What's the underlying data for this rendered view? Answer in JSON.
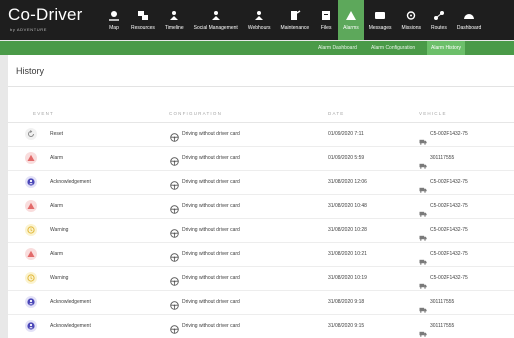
{
  "brand": {
    "name": "Co-Driver",
    "sub": "by ADVENTURE"
  },
  "nav": [
    {
      "label": "Map",
      "icon": "map-icon",
      "active": false
    },
    {
      "label": "Resources",
      "icon": "resources-icon",
      "active": false
    },
    {
      "label": "Timeline",
      "icon": "timeline-icon",
      "active": false
    },
    {
      "label": "Social Management",
      "icon": "social-management-icon",
      "active": false
    },
    {
      "label": "Webhours",
      "icon": "webhours-icon",
      "active": false
    },
    {
      "label": "Maintenance",
      "icon": "maintenance-icon",
      "active": false
    },
    {
      "label": "Files",
      "icon": "files-icon",
      "active": false
    },
    {
      "label": "Alarms",
      "icon": "alarms-icon",
      "active": true
    },
    {
      "label": "Messages",
      "icon": "messages-icon",
      "active": false
    },
    {
      "label": "Missions",
      "icon": "missions-icon",
      "active": false
    },
    {
      "label": "Routes",
      "icon": "routes-icon",
      "active": false
    },
    {
      "label": "Dashboard",
      "icon": "dashboard-icon",
      "active": false
    }
  ],
  "subnav": [
    {
      "label": "Alarm Dashboard",
      "active": false
    },
    {
      "label": "Alarm Configuration",
      "active": false
    },
    {
      "label": "Alarm History",
      "active": true
    }
  ],
  "page": {
    "title": "History"
  },
  "table": {
    "columns": {
      "event": "EVENT",
      "configuration": "CONFIGURATION",
      "date": "DATE",
      "vehicle": "VEHICLE"
    },
    "rows": [
      {
        "event": "Reset",
        "type": "reset",
        "configuration": "Driving without driver card",
        "date": "01/09/2020 7:11",
        "vehicle": "C5-002F1432-75"
      },
      {
        "event": "Alarm",
        "type": "alarm",
        "configuration": "Driving without driver card",
        "date": "01/09/2020 5:59",
        "vehicle": "301117555"
      },
      {
        "event": "Acknowledgement",
        "type": "ack",
        "configuration": "Driving without driver card",
        "date": "31/08/2020 12:06",
        "vehicle": "C5-002F1432-75"
      },
      {
        "event": "Alarm",
        "type": "alarm",
        "configuration": "Driving without driver card",
        "date": "31/08/2020 10:48",
        "vehicle": "C5-002F1432-75"
      },
      {
        "event": "Warning",
        "type": "warn",
        "configuration": "Driving without driver card",
        "date": "31/08/2020 10:28",
        "vehicle": "C5-002F1432-75"
      },
      {
        "event": "Alarm",
        "type": "alarm",
        "configuration": "Driving without driver card",
        "date": "31/08/2020 10:21",
        "vehicle": "C5-002F1432-75"
      },
      {
        "event": "Warning",
        "type": "warn",
        "configuration": "Driving without driver card",
        "date": "31/08/2020 10:19",
        "vehicle": "C5-002F1432-75"
      },
      {
        "event": "Acknowledgement",
        "type": "ack",
        "configuration": "Driving without driver card",
        "date": "31/08/2020 9:18",
        "vehicle": "301117555"
      },
      {
        "event": "Acknowledgement",
        "type": "ack",
        "configuration": "Driving without driver card",
        "date": "31/08/2020 9:15",
        "vehicle": "301117555"
      }
    ]
  },
  "colors": {
    "topbar": "#1e1e1e",
    "active_green": "#5da85b",
    "subnav_green": "#4a9a48",
    "alarm": "#e26a6a",
    "ack": "#4b47b8",
    "warn": "#e2b83a"
  }
}
